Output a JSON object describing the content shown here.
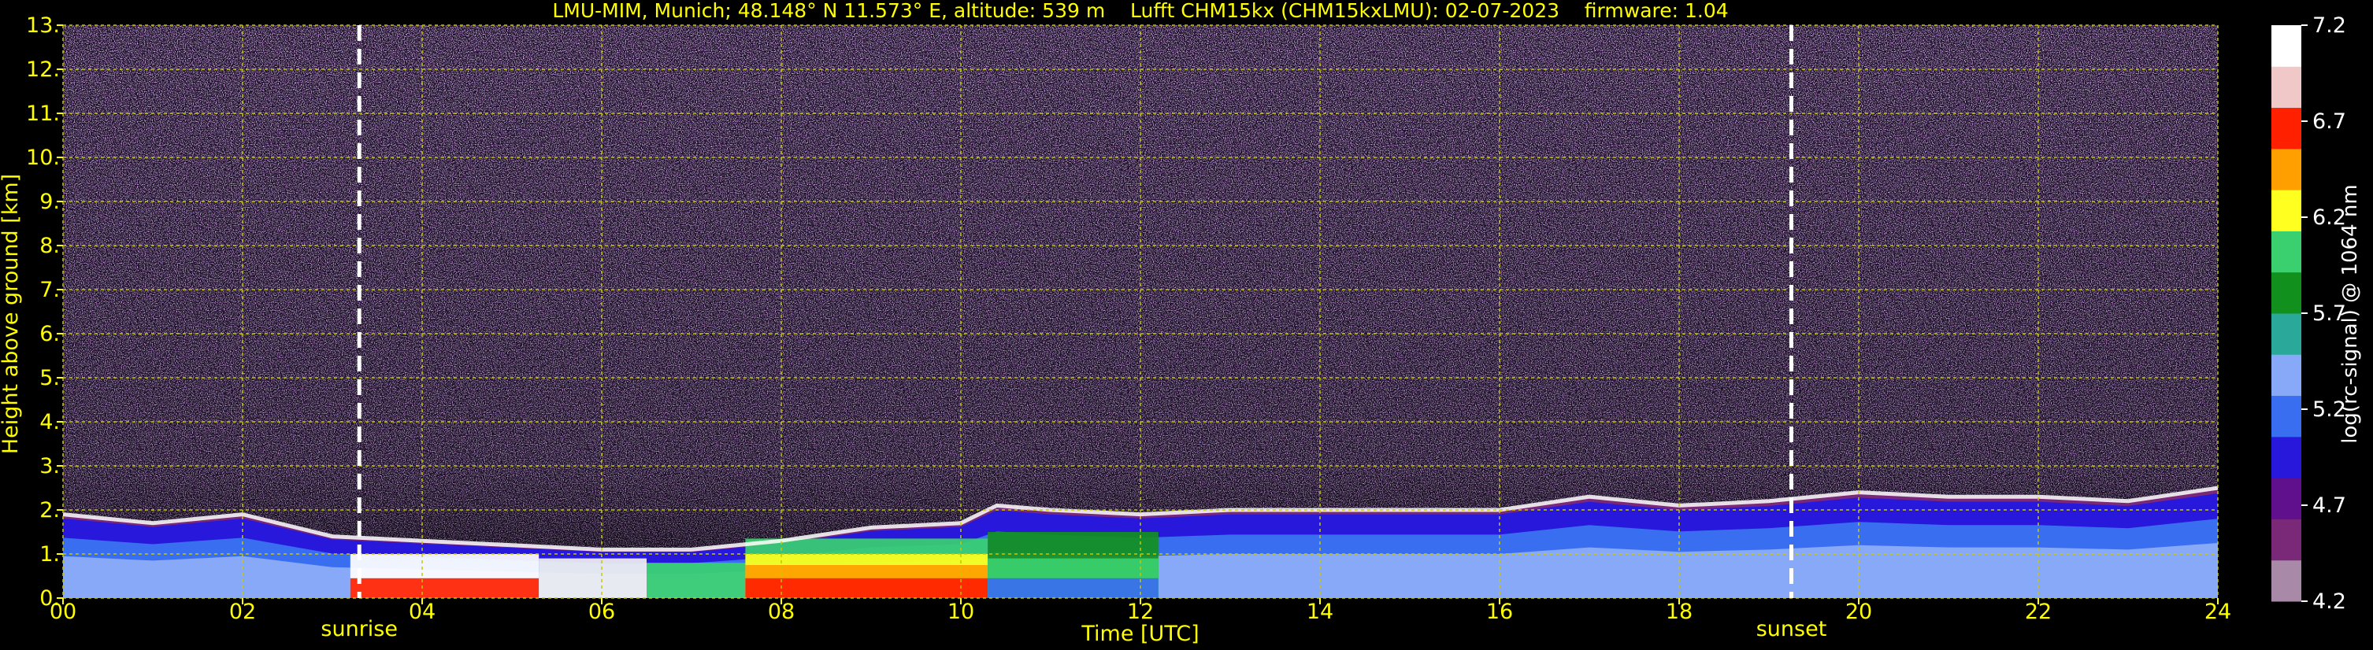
{
  "chart_data": {
    "type": "heatmap",
    "title": "LMU-MIM, Munich; 48.148° N 11.573° E, altitude: 539 m    Lufft CHM15kx (CHM15kxLMU): 02-07-2023    firmware: 1.04",
    "xlabel": "Time [UTC]",
    "ylabel": "Height above ground [km]",
    "xlim": [
      0,
      24
    ],
    "ylim": [
      0,
      13
    ],
    "x_ticks": [
      0,
      2,
      4,
      6,
      8,
      10,
      12,
      14,
      16,
      18,
      20,
      22,
      24
    ],
    "x_tick_labels": [
      "00",
      "02",
      "04",
      "06",
      "08",
      "10",
      "12",
      "14",
      "16",
      "18",
      "20",
      "22",
      "24"
    ],
    "y_ticks": [
      0,
      1,
      2,
      3,
      4,
      5,
      6,
      7,
      8,
      9,
      10,
      11,
      12,
      13
    ],
    "y_tick_labels": [
      "0.",
      "1.",
      "2.",
      "3.",
      "4.",
      "5.",
      "6.",
      "7.",
      "8.",
      "9.",
      "10.",
      "11.",
      "12.",
      "13."
    ],
    "grid": true,
    "markers": [
      {
        "label": "sunrise",
        "x": 3.3
      },
      {
        "label": "sunset",
        "x": 19.25
      }
    ],
    "colorbar": {
      "label": "log(rc-signal) @ 1064 nm",
      "range": [
        4.2,
        7.2
      ],
      "tick_values": [
        4.2,
        4.7,
        5.2,
        5.7,
        6.2,
        6.7,
        7.2
      ],
      "tick_labels": [
        "4.2",
        "4.7",
        "5.2",
        "5.7",
        "6.2",
        "6.7",
        "7.2"
      ]
    },
    "boundary_layer_top_km": [
      [
        0,
        1.9
      ],
      [
        1,
        1.7
      ],
      [
        2,
        1.9
      ],
      [
        3,
        1.4
      ],
      [
        4,
        1.3
      ],
      [
        5,
        1.2
      ],
      [
        6,
        1.1
      ],
      [
        7,
        1.1
      ],
      [
        8,
        1.3
      ],
      [
        9,
        1.6
      ],
      [
        10,
        1.7
      ],
      [
        10.4,
        2.1
      ],
      [
        11,
        2.0
      ],
      [
        12,
        1.9
      ],
      [
        13,
        2.0
      ],
      [
        14,
        2.0
      ],
      [
        15,
        2.0
      ],
      [
        16,
        2.0
      ],
      [
        17,
        2.3
      ],
      [
        18,
        2.1
      ],
      [
        19,
        2.2
      ],
      [
        20,
        2.4
      ],
      [
        21,
        2.3
      ],
      [
        22,
        2.3
      ],
      [
        23,
        2.2
      ],
      [
        24,
        2.5
      ]
    ]
  },
  "colors": {
    "text": "#ffff00",
    "grid": "#c8c800",
    "background": "#000000",
    "colormap": [
      "#a88aa8",
      "#7a2878",
      "#60108c",
      "#2818dc",
      "#3a6ef0",
      "#88a8f8",
      "#2aa89a",
      "#12901e",
      "#3ad070",
      "#ffff20",
      "#ffa000",
      "#ff2000",
      "#f0c8c8",
      "#ffffff"
    ]
  }
}
